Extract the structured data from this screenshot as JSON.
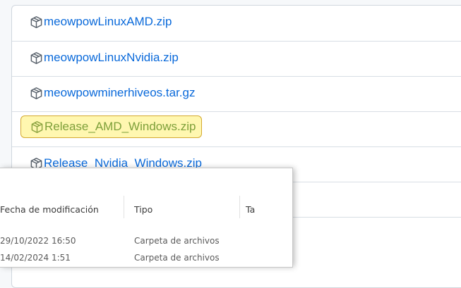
{
  "assets": [
    {
      "name": "meowpowLinuxAMD.zip",
      "icon": "package-icon"
    },
    {
      "name": "meowpowLinuxNvidia.zip",
      "icon": "package-icon"
    },
    {
      "name": "meowpowminerhiveos.tar.gz",
      "icon": "package-icon"
    },
    {
      "name": "Release_AMD_Windows.zip",
      "icon": "package-icon",
      "highlighted": true
    },
    {
      "name": "Release_Nvidia_Windows.zip",
      "icon": "package-icon"
    }
  ],
  "colors": {
    "link": "#0969da",
    "highlight_bg": "#fff7b0",
    "highlight_border": "#d4a92f",
    "highlight_text": "#7ea03a"
  },
  "explorer": {
    "columns": {
      "date": "Fecha de modificación",
      "type": "Tipo",
      "size": "Ta"
    },
    "rows": [
      {
        "date": "29/10/2022 16:50",
        "type": "Carpeta de archivos"
      },
      {
        "date": "14/02/2024 1:51",
        "type": "Carpeta de archivos"
      }
    ]
  }
}
